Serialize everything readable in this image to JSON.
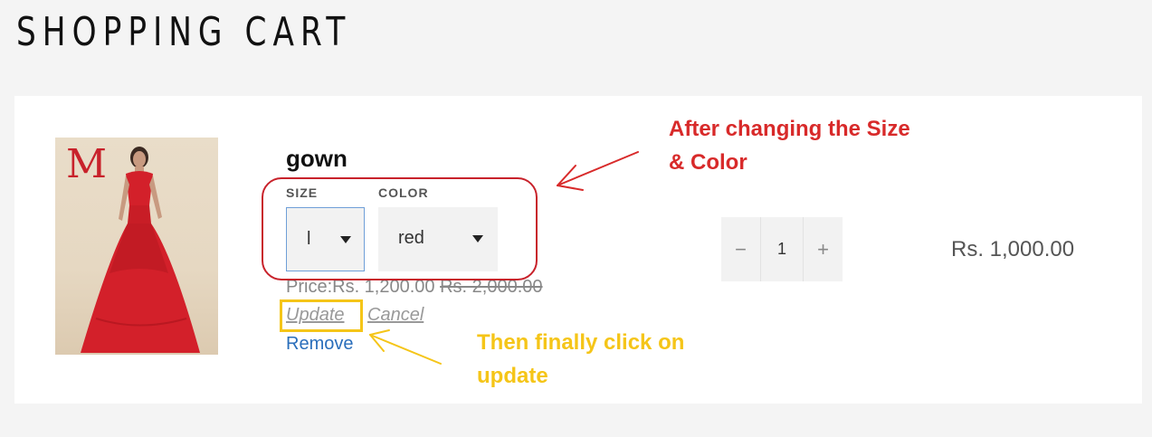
{
  "page": {
    "title": "SHOPPING CART"
  },
  "item": {
    "name": "gown",
    "image_logo": "M",
    "size_label": "SIZE",
    "size_value": "l",
    "color_label": "COLOR",
    "color_value": "red",
    "price_label": "Price:",
    "price_current": "Rs. 1,200.00",
    "price_original": "Rs. 2,000.00",
    "update_label": "Update",
    "cancel_label": "Cancel",
    "remove_label": "Remove",
    "quantity": "1",
    "minus_symbol": "−",
    "plus_symbol": "+",
    "line_total": "Rs. 1,000.00"
  },
  "annotations": {
    "red_line1": "After changing the Size",
    "red_line2": "& Color",
    "yellow_line1": "Then finally click on",
    "yellow_line2": "update",
    "red_color": "#d82a2a",
    "yellow_color": "#f5c518"
  },
  "colors": {
    "background": "#f4f4f4",
    "panel": "#ffffff",
    "link_blue": "#2a6ebb",
    "dress_red": "#d3202a"
  }
}
